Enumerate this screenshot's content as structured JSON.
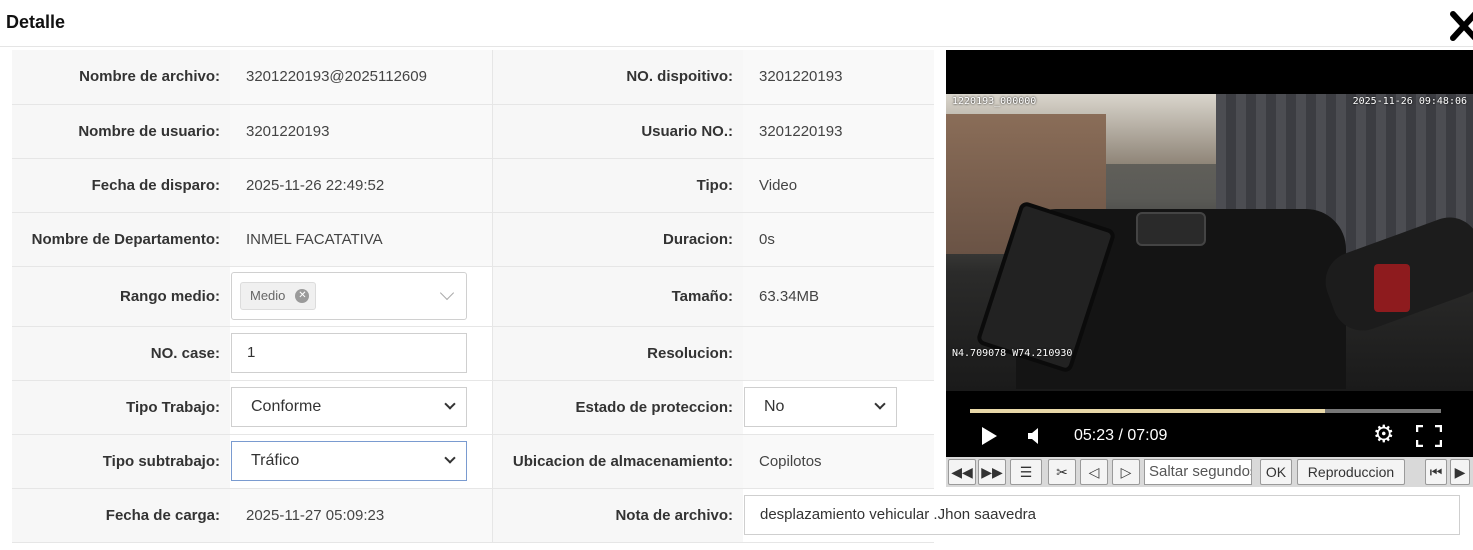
{
  "header": {
    "title": "Detalle"
  },
  "rows": [
    {
      "label1": "Nombre de archivo:",
      "value1": "3201220193@2025112609",
      "label2": "NO. dispoitivo:",
      "value2": "3201220193"
    },
    {
      "label1": "Nombre de usuario:",
      "value1": "3201220193",
      "label2": "Usuario NO.:",
      "value2": "3201220193"
    },
    {
      "label1": "Fecha de disparo:",
      "value1": "2025-11-26 22:49:52",
      "label2": "Tipo:",
      "value2": "Video"
    },
    {
      "label1": "Nombre de Departamento:",
      "value1": "INMEL FACATATIVA",
      "label2": "Duracion:",
      "value2": "0s"
    },
    {
      "label1": "Rango medio:",
      "tag": "Medio",
      "label2": "Tamaño:",
      "value2": "63.34MB"
    },
    {
      "label1": "NO. case:",
      "input_value": "1",
      "label2": "Resolucion:",
      "value2": ""
    },
    {
      "label1": "Tipo Trabajo:",
      "select_value": "Conforme",
      "label2": "Estado de proteccion:",
      "select2_value": "No"
    },
    {
      "label1": "Tipo subtrabajo:",
      "select_value": "Tráfico",
      "label2": "Ubicacion de almacenamiento:",
      "value2": "Copilotos"
    },
    {
      "label1": "Fecha de carga:",
      "value1": "2025-11-27 05:09:23",
      "label2": "Nota de archivo:",
      "note_value": "desplazamiento vehicular .Jhon saavedra"
    }
  ],
  "player": {
    "overlay_id": "1220193_000000",
    "overlay_datetime": "2025-11-26 09:48:06",
    "overlay_gps": "N4.709078 W74.210930",
    "time": "05:23 / 07:09",
    "progress": 0.753,
    "icons": [
      "play-icon",
      "volume-icon",
      "settings-icon",
      "fullscreen-icon"
    ]
  },
  "toolbar": {
    "seek_placeholder": "Saltar segundos",
    "ok_label": "OK",
    "playback_label": "Reproduccion",
    "icons": [
      "rewind-icon",
      "fast-forward-icon",
      "list-icon",
      "scissors-icon",
      "prev-frame-icon",
      "next-frame-icon",
      "skip-start-icon",
      "step-forward-icon"
    ]
  }
}
